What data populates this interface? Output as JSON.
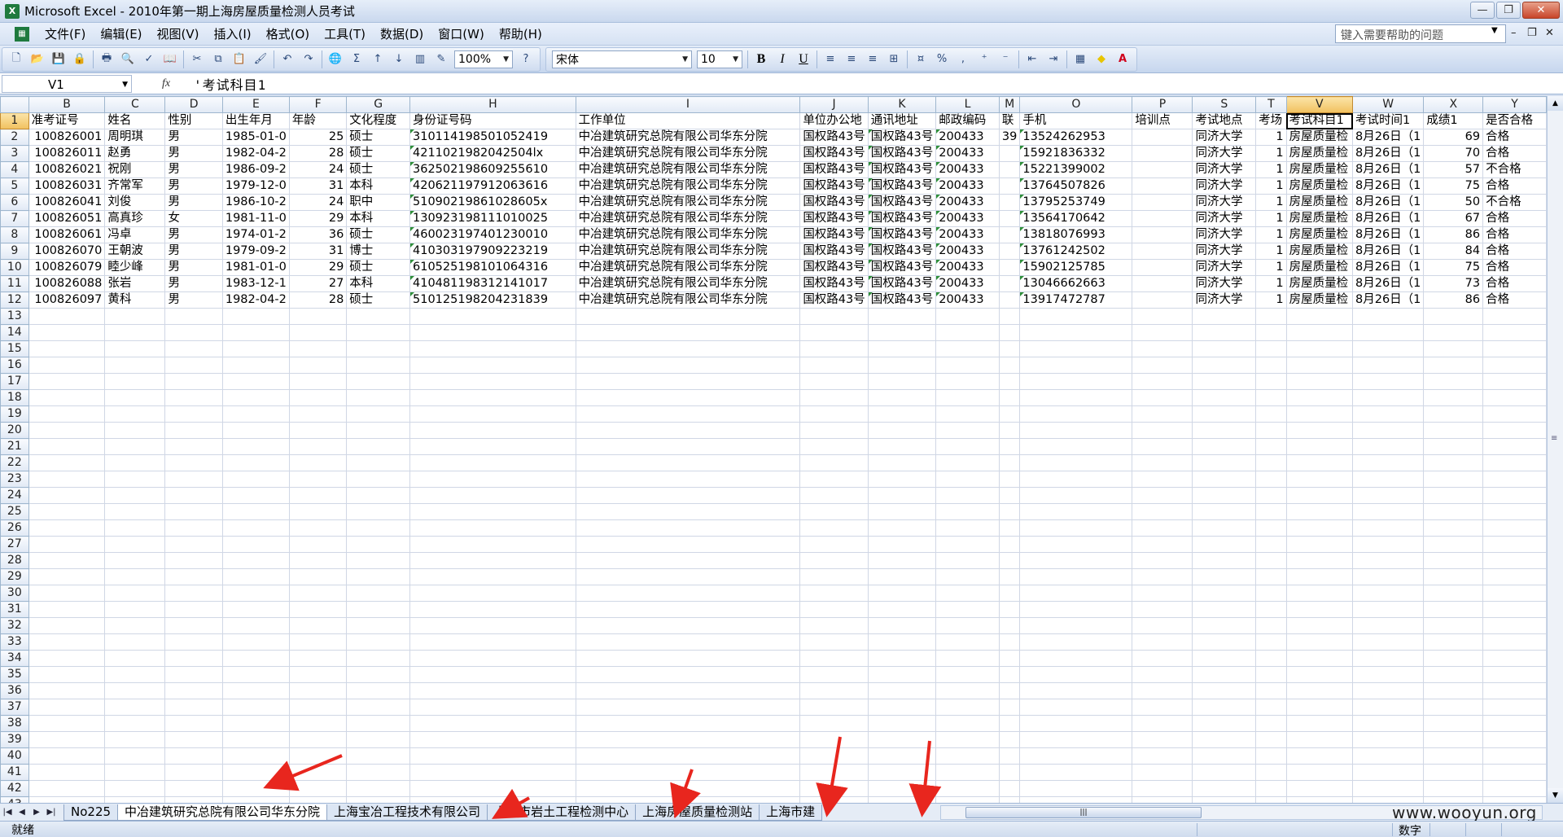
{
  "app": {
    "title": "Microsoft Excel - 2010年第一期上海房屋质量检测人员考试",
    "icon": "X"
  },
  "menu": [
    "文件(F)",
    "编辑(E)",
    "视图(V)",
    "插入(I)",
    "格式(O)",
    "工具(T)",
    "数据(D)",
    "窗口(W)",
    "帮助(H)"
  ],
  "help_placeholder": "键入需要帮助的问题",
  "toolbar": {
    "zoom": "100%",
    "font": "宋体",
    "font_size": "10"
  },
  "formula": {
    "name_box": "V1",
    "fx": "fx",
    "content": "'考试科目1"
  },
  "columns": [
    "B",
    "C",
    "D",
    "E",
    "F",
    "G",
    "H",
    "I",
    "J",
    "K",
    "L",
    "M",
    "O",
    "P",
    "S",
    "T",
    "V",
    "W",
    "X",
    "Y"
  ],
  "header_row": [
    "准考证号",
    "姓名",
    "性别",
    "出生年月",
    "年龄",
    "文化程度",
    "身份证号码",
    "工作单位",
    "单位办公地",
    "通讯地址",
    "邮政编码",
    "联",
    "手机",
    "培训点",
    "考试地点",
    "考场",
    "考试科目1",
    "考试时间1",
    "成绩1",
    "是否合格"
  ],
  "rows": [
    [
      "100826001",
      "周明琪",
      "男",
      "1985-01-0",
      "25",
      "硕士",
      "310114198501052419",
      "中冶建筑研究总院有限公司华东分院",
      "国权路43号",
      "国权路43号",
      "200433",
      "39",
      "13524262953",
      "",
      "同济大学",
      "1",
      "房屋质量检",
      "8月26日（1",
      "69",
      "合格"
    ],
    [
      "100826011",
      "赵勇",
      "男",
      "1982-04-2",
      "28",
      "硕士",
      "4211021982042504lx",
      "中冶建筑研究总院有限公司华东分院",
      "国权路43号",
      "国权路43号",
      "200433",
      "",
      "15921836332",
      "",
      "同济大学",
      "1",
      "房屋质量检",
      "8月26日（1",
      "70",
      "合格"
    ],
    [
      "100826021",
      "祝刚",
      "男",
      "1986-09-2",
      "24",
      "硕士",
      "362502198609255610",
      "中冶建筑研究总院有限公司华东分院",
      "国权路43号",
      "国权路43号",
      "200433",
      "",
      "15221399002",
      "",
      "同济大学",
      "1",
      "房屋质量检",
      "8月26日（1",
      "57",
      "不合格"
    ],
    [
      "100826031",
      "齐常军",
      "男",
      "1979-12-0",
      "31",
      "本科",
      "420621197912063616",
      "中冶建筑研究总院有限公司华东分院",
      "国权路43号",
      "国权路43号",
      "200433",
      "",
      "13764507826",
      "",
      "同济大学",
      "1",
      "房屋质量检",
      "8月26日（1",
      "75",
      "合格"
    ],
    [
      "100826041",
      "刘俊",
      "男",
      "1986-10-2",
      "24",
      "职中",
      "51090219861028605x",
      "中冶建筑研究总院有限公司华东分院",
      "国权路43号",
      "国权路43号",
      "200433",
      "",
      "13795253749",
      "",
      "同济大学",
      "1",
      "房屋质量检",
      "8月26日（1",
      "50",
      "不合格"
    ],
    [
      "100826051",
      "高真珍",
      "女",
      "1981-11-0",
      "29",
      "本科",
      "130923198111010025",
      "中冶建筑研究总院有限公司华东分院",
      "国权路43号",
      "国权路43号",
      "200433",
      "",
      "13564170642",
      "",
      "同济大学",
      "1",
      "房屋质量检",
      "8月26日（1",
      "67",
      "合格"
    ],
    [
      "100826061",
      "冯卓",
      "男",
      "1974-01-2",
      "36",
      "硕士",
      "460023197401230010",
      "中冶建筑研究总院有限公司华东分院",
      "国权路43号",
      "国权路43号",
      "200433",
      "",
      "13818076993",
      "",
      "同济大学",
      "1",
      "房屋质量检",
      "8月26日（1",
      "86",
      "合格"
    ],
    [
      "100826070",
      "王朝波",
      "男",
      "1979-09-2",
      "31",
      "博士",
      "410303197909223219",
      "中冶建筑研究总院有限公司华东分院",
      "国权路43号",
      "国权路43号",
      "200433",
      "",
      "13761242502",
      "",
      "同济大学",
      "1",
      "房屋质量检",
      "8月26日（1",
      "84",
      "合格"
    ],
    [
      "100826079",
      "睦少峰",
      "男",
      "1981-01-0",
      "29",
      "硕士",
      "610525198101064316",
      "中冶建筑研究总院有限公司华东分院",
      "国权路43号",
      "国权路43号",
      "200433",
      "",
      "15902125785",
      "",
      "同济大学",
      "1",
      "房屋质量检",
      "8月26日（1",
      "75",
      "合格"
    ],
    [
      "100826088",
      "张岩",
      "男",
      "1983-12-1",
      "27",
      "本科",
      "410481198312141017",
      "中冶建筑研究总院有限公司华东分院",
      "国权路43号",
      "国权路43号",
      "200433",
      "",
      "13046662663",
      "",
      "同济大学",
      "1",
      "房屋质量检",
      "8月26日（1",
      "73",
      "合格"
    ],
    [
      "100826097",
      "黄科",
      "男",
      "1982-04-2",
      "28",
      "硕士",
      "510125198204231839",
      "中冶建筑研究总院有限公司华东分院",
      "国权路43号",
      "国权路43号",
      "200433",
      "",
      "13917472787",
      "",
      "同济大学",
      "1",
      "房屋质量检",
      "8月26日（1",
      "86",
      "合格"
    ]
  ],
  "row_count": 43,
  "sheet_tabs": [
    "No225",
    "中冶建筑研究总院有限公司华东分院",
    "上海宝冶工程技术有限公司",
    "上海市岩土工程检测中心",
    "上海房屋质量检测站",
    "上海市建"
  ],
  "status": {
    "ready": "就绪",
    "mode": "数字"
  },
  "watermark": "www.wooyun.org",
  "colors": {
    "arrow": "#e8261e",
    "active_header": "#f1c15f"
  }
}
